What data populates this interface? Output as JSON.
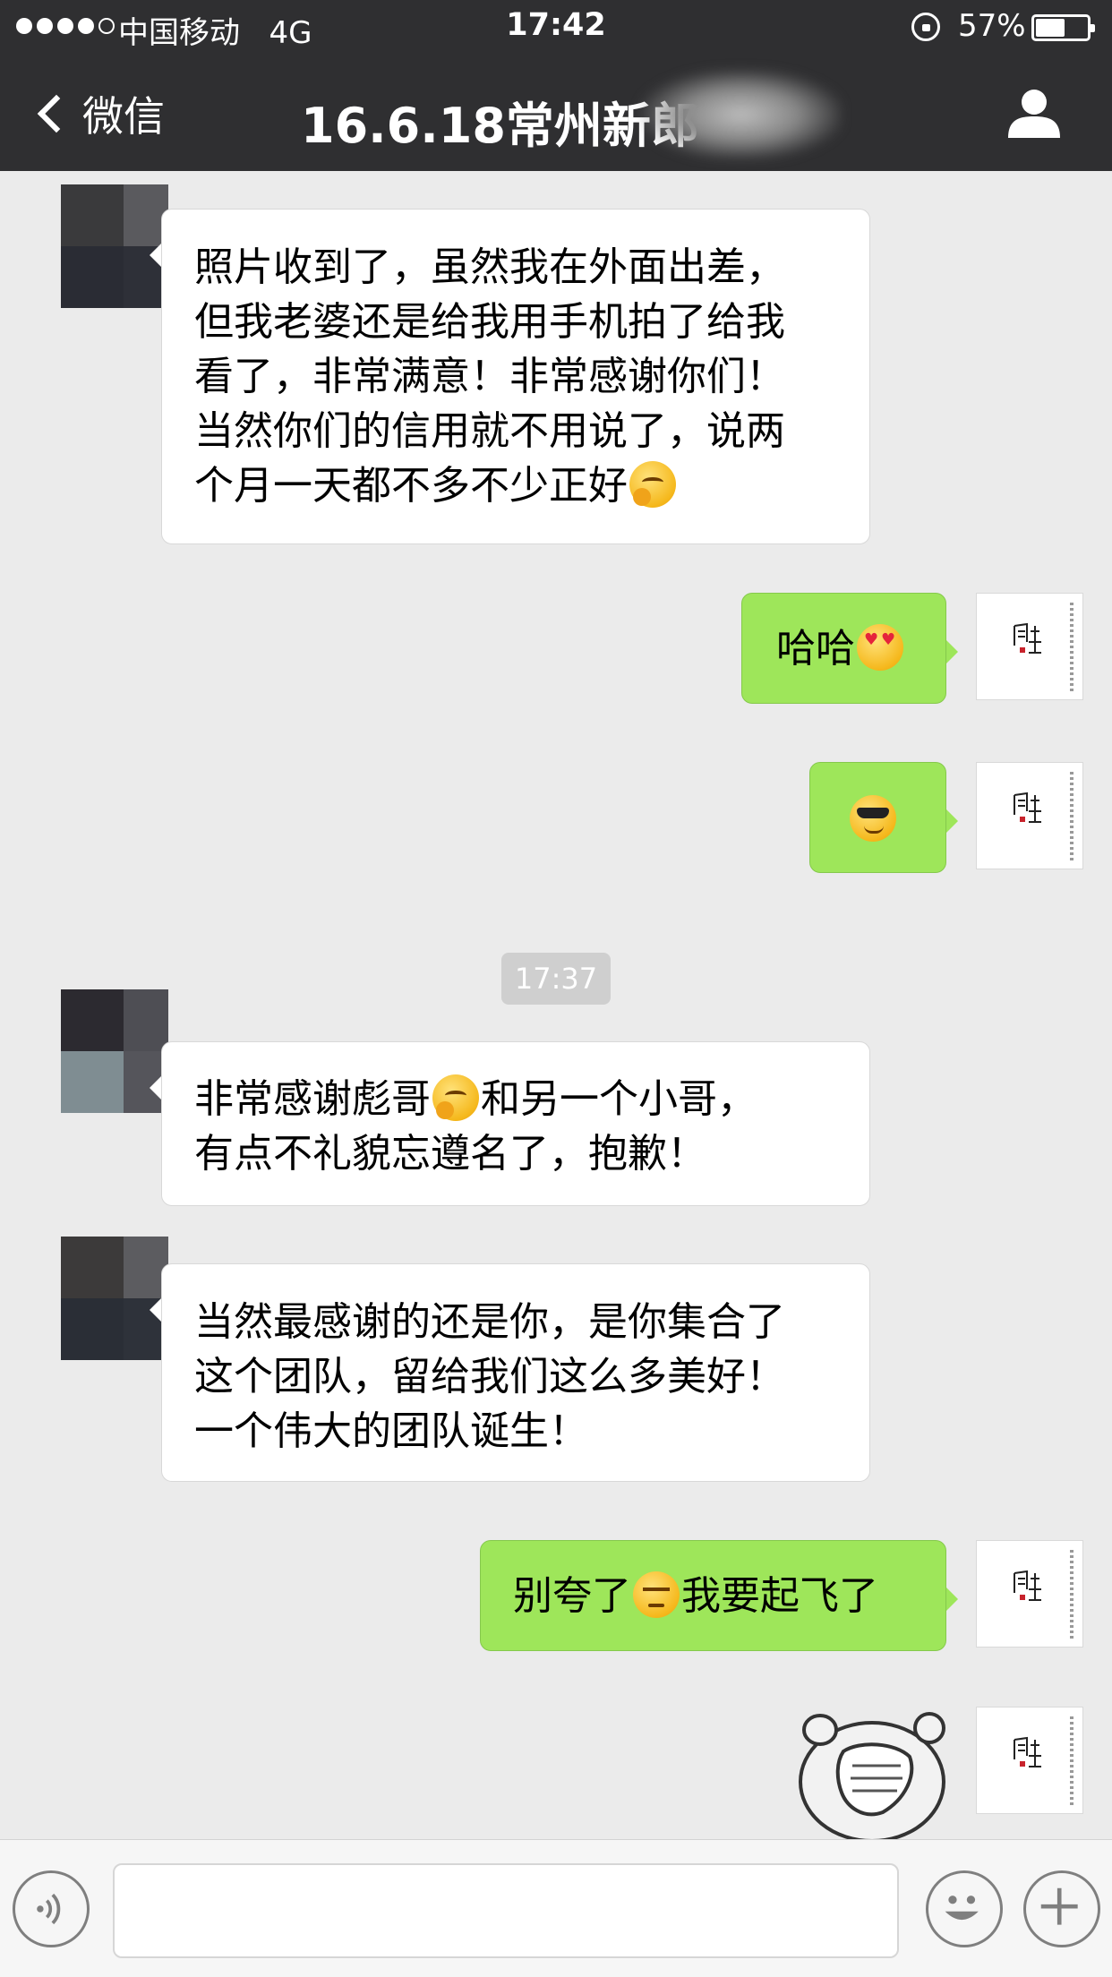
{
  "status_bar": {
    "signal_bars": 5,
    "signal_filled": 4,
    "carrier": "中国移动",
    "network": "4G",
    "time": "17:42",
    "battery_percent_label": "57%",
    "battery_level": 0.57
  },
  "nav": {
    "back_label": "微信",
    "title": "16.6.18常州新郎",
    "profile_icon": "person-icon"
  },
  "messages": [
    {
      "side": "in",
      "text": "照片收到了，虽然我在外面出差，\n但我老婆还是给我用手机拍了给我\n看了，非常满意！非常感谢你们！\n当然你们的信用就不用说了，说两\n个月一天都不多不少正好",
      "emoji": "thinking-emoji"
    },
    {
      "side": "out",
      "text": "哈哈",
      "emoji": "heart-eyes-emoji"
    },
    {
      "side": "out",
      "text": "",
      "emoji": "sunglasses-emoji"
    },
    {
      "side": "in",
      "text_before": "非常感谢彪哥",
      "emoji": "thinking-emoji",
      "text_after": "和另一个小哥，\n有点不礼貌忘遵名了，抱歉！"
    },
    {
      "side": "in",
      "text": "当然最感谢的还是你，是你集合了\n这个团队，留给我们这么多美好！\n一个伟大的团队诞生！"
    },
    {
      "side": "out",
      "text_before": "别夸了",
      "emoji": "unamused-emoji",
      "text_after": "我要起飞了"
    }
  ],
  "timestamp": "17:37",
  "self_avatar_text": "周生",
  "sticker": "face-palm-bear-sticker",
  "input_bar": {
    "voice_icon": "voice-icon",
    "emoji_icon": "smiley-icon",
    "plus_icon": "plus-icon",
    "input_value": ""
  },
  "colors": {
    "header_bg": "#2f2f31",
    "chat_bg": "#ebebeb",
    "out_bubble": "#9ee65a",
    "in_bubble": "#ffffff"
  }
}
